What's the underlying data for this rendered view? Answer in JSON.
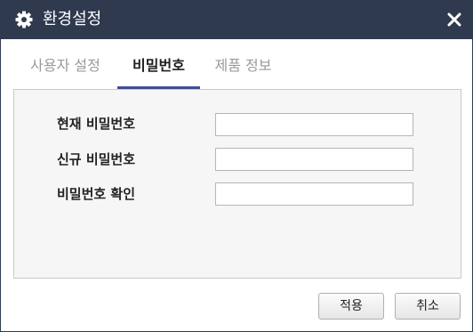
{
  "window": {
    "title": "환경설정",
    "icon": "gear-icon",
    "close_icon": "close-icon"
  },
  "tabs": [
    {
      "label": "사용자 설정",
      "active": false
    },
    {
      "label": "비밀번호",
      "active": true
    },
    {
      "label": "제품 정보",
      "active": false
    }
  ],
  "form": {
    "fields": [
      {
        "label": "현재 비밀번호",
        "value": ""
      },
      {
        "label": "신규 비밀번호",
        "value": ""
      },
      {
        "label": "비밀번호 확인",
        "value": ""
      }
    ]
  },
  "buttons": {
    "apply": "적용",
    "cancel": "취소"
  },
  "colors": {
    "titlebar": "#2f3a4f",
    "active_tab_underline": "#3f4f95",
    "panel_bg": "#f6f6f6"
  }
}
